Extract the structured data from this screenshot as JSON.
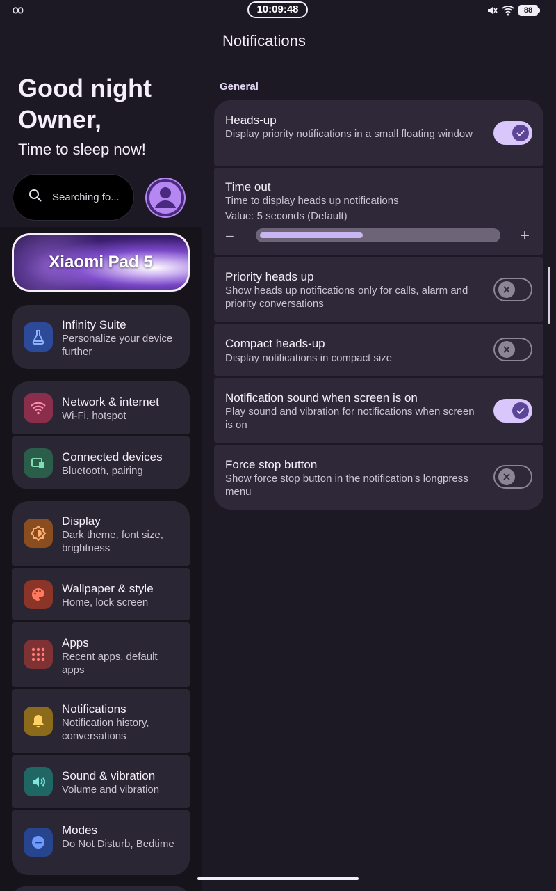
{
  "status_bar": {
    "time": "10:09:48",
    "battery": "88",
    "left_icon": "infinity-icon",
    "icons": [
      "mute-icon",
      "wifi-icon",
      "battery-icon"
    ]
  },
  "sidebar": {
    "greeting_line1": "Good night",
    "greeting_line2": "Owner,",
    "sleep_text": "Time to sleep now!",
    "search_placeholder": "Searching fo...",
    "device_name": "Xiaomi Pad 5",
    "items": [
      {
        "title": "Infinity Suite",
        "subtitle": "Personalize your device further",
        "icon": "flask-icon",
        "color": "#3a63c8"
      },
      {
        "title": "Network & internet",
        "subtitle": "Wi-Fi, hotspot",
        "icon": "wifi-icon",
        "color": "#c2365c"
      },
      {
        "title": "Connected devices",
        "subtitle": "Bluetooth, pairing",
        "icon": "devices-icon",
        "color": "#2f6f57"
      },
      {
        "title": "Display",
        "subtitle": "Dark theme, font size, brightness",
        "icon": "brightness-icon",
        "color": "#c06a20"
      },
      {
        "title": "Wallpaper & style",
        "subtitle": "Home, lock screen",
        "icon": "palette-icon",
        "color": "#c5402e"
      },
      {
        "title": "Apps",
        "subtitle": "Recent apps, default apps",
        "icon": "apps-grid-icon",
        "color": "#b2433b"
      },
      {
        "title": "Notifications",
        "subtitle": "Notification history, conversations",
        "icon": "bell-icon",
        "color": "#b58a18"
      },
      {
        "title": "Sound & vibration",
        "subtitle": "Volume and vibration",
        "icon": "volume-icon",
        "color": "#258a87"
      },
      {
        "title": "Modes",
        "subtitle": "Do Not Disturb, Bedtime",
        "icon": "dnd-icon",
        "color": "#2f5cc6"
      }
    ]
  },
  "main": {
    "title": "Notifications",
    "section": "General",
    "settings": [
      {
        "title": "Heads-up",
        "subtitle": "Display priority notifications in a small floating window",
        "enabled": true
      },
      {
        "title": "Time out",
        "subtitle": "Time to display heads up notifications",
        "value_text": "Value: 5 seconds (Default)",
        "slider_fraction": 0.42
      },
      {
        "title": "Priority heads up",
        "subtitle": "Show heads up notifications only for calls, alarm and priority conversations",
        "enabled": false
      },
      {
        "title": "Compact heads-up",
        "subtitle": "Display notifications in compact size",
        "enabled": false
      },
      {
        "title": "Notification sound when screen is on",
        "subtitle": "Play sound and vibration for notifications when screen is on",
        "enabled": true
      },
      {
        "title": "Force stop button",
        "subtitle": "Show force stop button in the notification's longpress menu",
        "enabled": false
      }
    ]
  },
  "colors": {
    "accent": "#d9c6fb",
    "card": "#2e2838",
    "background": "#1d1924"
  }
}
